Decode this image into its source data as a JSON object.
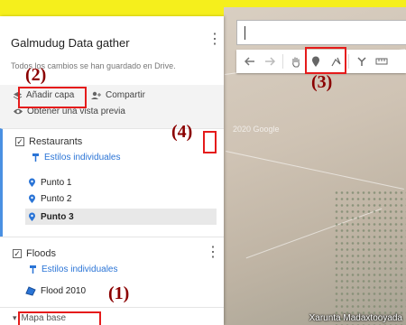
{
  "panel": {
    "title": "Galmudug Data gather",
    "saved_status": "Todos los cambios se han guardado en Drive.",
    "menu_icon": "more-vert-icon",
    "actions": {
      "add_layer": "Añadir capa",
      "share": "Compartir",
      "preview": "Obtener una vista previa"
    },
    "layers": [
      {
        "name": "Restaurants",
        "style": "Estilos individuales",
        "items": [
          "Punto 1",
          "Punto 2",
          "Punto 3"
        ],
        "selected_item": "Punto 3"
      },
      {
        "name": "Floods",
        "style": "Estilos individuales",
        "items": [
          "Flood 2010"
        ]
      }
    ],
    "base_map": "Mapa base"
  },
  "map": {
    "watermark": "2020 Google",
    "place_label": "Xarunta Madaxtooyada"
  },
  "annotations": [
    "(1)",
    "(2)",
    "(3)",
    "(4)"
  ],
  "colors": {
    "background": "#f5ef1c",
    "accent": "#2a74d6",
    "annotation_box": "#e51b1b"
  }
}
